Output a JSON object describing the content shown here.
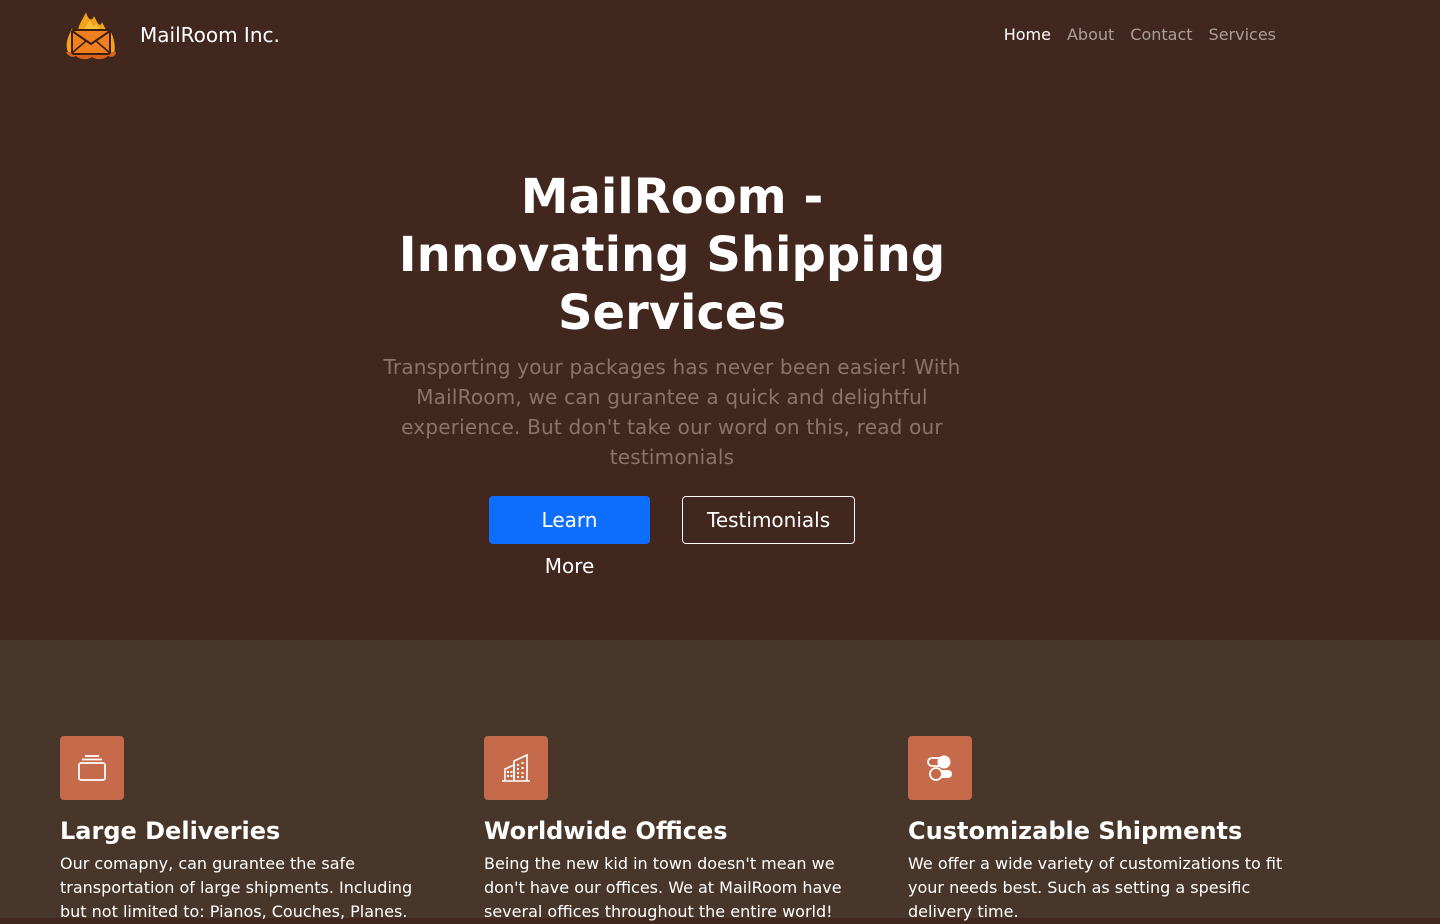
{
  "navbar": {
    "brand_name": "MailRoom Inc.",
    "logo_icon": "flaming-envelope-logo",
    "links": [
      {
        "label": "Home",
        "active": true
      },
      {
        "label": "About",
        "active": false
      },
      {
        "label": "Contact",
        "active": false
      },
      {
        "label": "Services",
        "active": false
      }
    ]
  },
  "hero": {
    "title": "MailRoom - Innovating Shipping Services",
    "lead": "Transporting your packages has never been easier! With MailRoom, we can gurantee a quick and delightful experience. But don't take our word on this, read our testimonials",
    "primary_button": "Learn More",
    "secondary_button": "Testimonials"
  },
  "features": [
    {
      "icon": "collection-icon",
      "title": "Large Deliveries",
      "text": "Our comapny, can gurantee the safe transportation of large shipments. Including but not limited to: Pianos, Couches, Planes."
    },
    {
      "icon": "building-icon",
      "title": "Worldwide Offices",
      "text": "Being the new kid in town doesn't mean we don't have our offices. We at MailRoom have several offices throughout the entire world!"
    },
    {
      "icon": "toggles-icon",
      "title": "Customizable Shipments",
      "text": "We offer a wide variety of customizations to fit your needs best. Such as setting a spesific delivery time."
    }
  ],
  "colors": {
    "background": "#41271e",
    "features_background": "#49362a",
    "feature_icon_bg": "#c56b4c",
    "primary": "#0d6efd",
    "lead_text": "#8d7368"
  }
}
